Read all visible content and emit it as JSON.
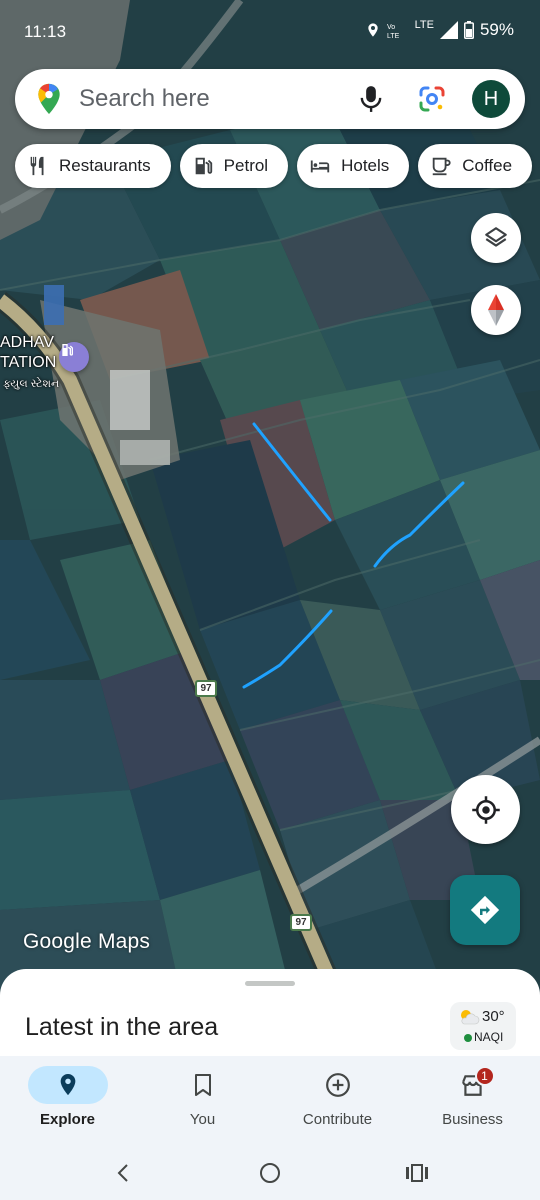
{
  "status_bar": {
    "time": "11:13",
    "network": "LTE",
    "battery": "59%"
  },
  "search": {
    "placeholder": "Search here",
    "avatar_letter": "H"
  },
  "chips": [
    {
      "label": "Restaurants",
      "icon": "fork-knife-icon"
    },
    {
      "label": "Petrol",
      "icon": "fuel-pump-icon"
    },
    {
      "label": "Hotels",
      "icon": "bed-icon"
    },
    {
      "label": "Coffee",
      "icon": "coffee-cup-icon"
    }
  ],
  "map": {
    "place_label_line1": "ADHAV",
    "place_label_line2": "TATION",
    "place_label_local": "ફ્યુલ સ્ટેશન",
    "route_number": "97",
    "logo": "Google Maps",
    "colors": {
      "road": "#b5ac86",
      "drawn_line": "#1fa2ff",
      "accent": "#137a7f"
    }
  },
  "sheet": {
    "title": "Latest in the area",
    "weather_temp": "30°",
    "aqi_label": "NAQI"
  },
  "nav": {
    "items": [
      {
        "label": "Explore",
        "icon": "explore-pin-icon",
        "active": true
      },
      {
        "label": "You",
        "icon": "bookmark-icon",
        "active": false
      },
      {
        "label": "Contribute",
        "icon": "add-circle-icon",
        "active": false
      },
      {
        "label": "Business",
        "icon": "storefront-icon",
        "active": false,
        "badge": "1"
      }
    ]
  }
}
